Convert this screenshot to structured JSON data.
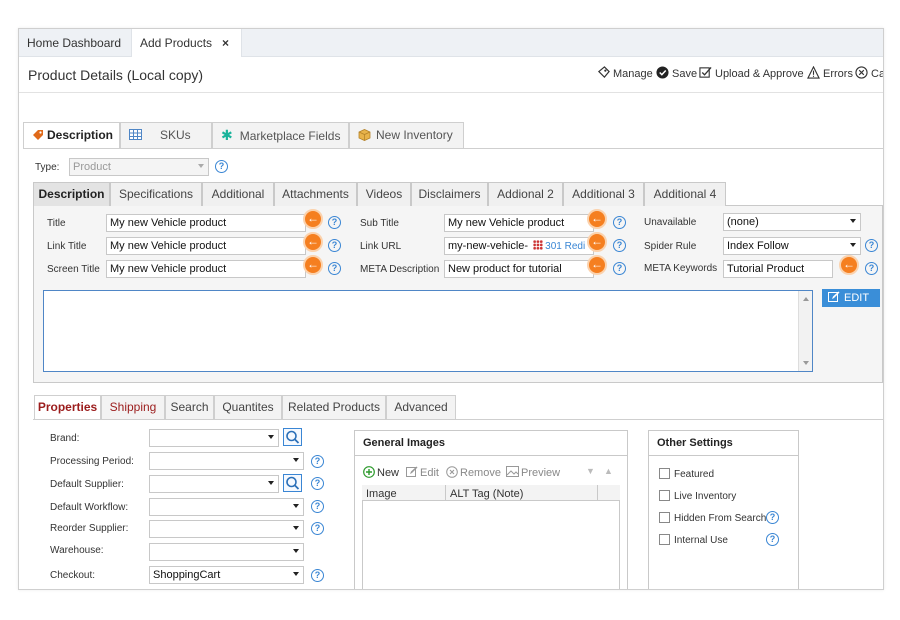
{
  "top_tabs": [
    {
      "label": "Home Dashboard"
    },
    {
      "label": "Add Products",
      "close": "×"
    }
  ],
  "header": {
    "title": "Product Details (Local copy)",
    "actions": {
      "manage": "Manage",
      "save": "Save",
      "upload": "Upload & Approve",
      "errors": "Errors",
      "cancel": "Ca"
    }
  },
  "main_tabs": [
    {
      "label": "Description",
      "icon": "tag-icon"
    },
    {
      "label": "SKUs",
      "icon": "grid-icon"
    },
    {
      "label": "Marketplace Fields",
      "icon": "asterisk-icon"
    },
    {
      "label": "New Inventory",
      "icon": "box-icon"
    }
  ],
  "type_field": {
    "label": "Type:",
    "value": "Product"
  },
  "sub_tabs": [
    "Description",
    "Specifications",
    "Additional",
    "Attachments",
    "Videos",
    "Disclaimers",
    "Addional 2",
    "Additional 3",
    "Additional 4"
  ],
  "fields": {
    "title": {
      "label": "Title",
      "value": "My new Vehicle product"
    },
    "link_title": {
      "label": "Link Title",
      "value": "My new Vehicle product"
    },
    "screen_title": {
      "label": "Screen Title",
      "value": "My new Vehicle product"
    },
    "sub_title": {
      "label": "Sub Title",
      "value": "My new Vehicle product"
    },
    "link_url": {
      "label": "Link URL",
      "value": "my-new-vehicle-",
      "redirect": "301 Redi"
    },
    "meta_description": {
      "label": "META Description",
      "value": "New product for tutorial"
    },
    "unavailable": {
      "label": "Unavailable",
      "value": "(none)"
    },
    "spider_rule": {
      "label": "Spider Rule",
      "value": "Index Follow"
    },
    "meta_keywords": {
      "label": "META Keywords",
      "value": "Tutorial Product"
    }
  },
  "edit_button": "EDIT",
  "arrow_glyph": "←",
  "help_glyph": "?",
  "property_tabs": [
    "Properties",
    "Shipping",
    "Search",
    "Quantites",
    "Related Products",
    "Advanced"
  ],
  "properties": {
    "brand": {
      "label": "Brand:",
      "value": ""
    },
    "processing_period": {
      "label": "Processing Period:",
      "value": ""
    },
    "default_supplier": {
      "label": "Default Supplier:",
      "value": ""
    },
    "default_workflow": {
      "label": "Default Workflow:",
      "value": ""
    },
    "reorder_supplier": {
      "label": "Reorder Supplier:",
      "value": ""
    },
    "warehouse": {
      "label": "Warehouse:",
      "value": ""
    },
    "checkout": {
      "label": "Checkout:",
      "value": "ShoppingCart"
    }
  },
  "general_images": {
    "title": "General Images",
    "toolbar": {
      "new": "New",
      "edit": "Edit",
      "remove": "Remove",
      "preview": "Preview"
    },
    "columns": [
      "Image",
      "ALT Tag (Note)"
    ]
  },
  "other_settings": {
    "title": "Other Settings",
    "items": [
      "Featured",
      "Live Inventory",
      "Hidden From Search",
      "Internal Use"
    ]
  },
  "colors": {
    "accent": "#f57f20",
    "link": "#3a86d4",
    "tab_red": "#9b1c1c"
  }
}
